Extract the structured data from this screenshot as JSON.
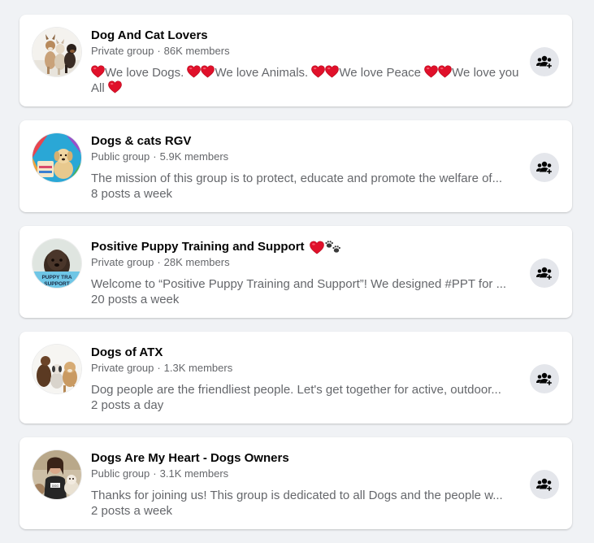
{
  "groups": [
    {
      "name": "Dog And Cat Lovers",
      "privacy": "Private group",
      "members": "86K members",
      "description_parts": [
        "We love Dogs. ",
        "We love Animals. ",
        "We love Peace ",
        "We love you All "
      ],
      "activity": ""
    },
    {
      "name": "Dogs & cats RGV",
      "privacy": "Public group",
      "members": "5.9K members",
      "description": "The mission of this group is to protect, educate and promote the welfare of...",
      "activity": "8 posts a week"
    },
    {
      "name": "Positive Puppy Training and Support",
      "privacy": "Private group",
      "members": "28K members",
      "description": "Welcome to “Positive Puppy Training and Support”! We designed #PPT for ...",
      "activity": "20 posts a week",
      "avatar_text": "PUPPY TRA SUPPORT"
    },
    {
      "name": "Dogs of ATX",
      "privacy": "Private group",
      "members": "1.3K members",
      "description": "Dog people are the friendliest people. Let's get together for active, outdoor...",
      "activity": "2 posts a day"
    },
    {
      "name": "Dogs Are My Heart - Dogs Owners",
      "privacy": "Public group",
      "members": "3.1K members",
      "description": "Thanks for joining us! This group is dedicated to all Dogs and the people w...",
      "activity": "2 posts a week"
    }
  ],
  "separator": "·",
  "icons": {
    "join": "join-group-icon",
    "heart": "red-heart-icon",
    "paws": "paw-prints-icon"
  },
  "colors": {
    "page_bg": "#f0f2f5",
    "card_bg": "#ffffff",
    "title": "#050505",
    "secondary": "#65676b",
    "button_bg": "#e4e6eb",
    "heart": "#e0102a"
  }
}
